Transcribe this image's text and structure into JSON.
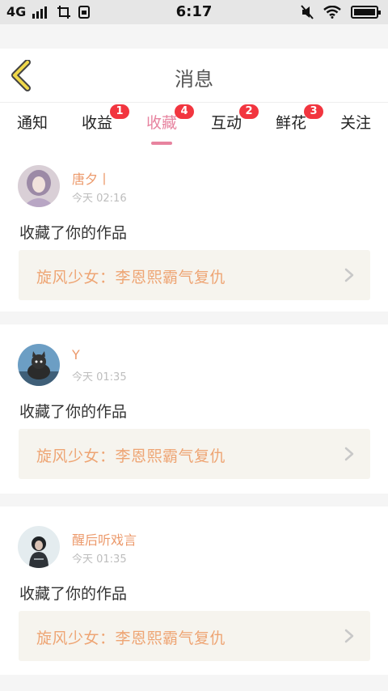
{
  "status_bar": {
    "network": "4G",
    "time": "6:17",
    "icons": [
      "signal-bars-icon",
      "screenshot-icon",
      "sim-icon",
      "mute-icon",
      "wifi-icon",
      "battery-icon"
    ]
  },
  "header": {
    "title": "消息",
    "back_icon": "chevron-left-icon",
    "back_color": "#f0d84a"
  },
  "tabs": [
    {
      "label": "通知",
      "badge": ""
    },
    {
      "label": "收益",
      "badge": "1"
    },
    {
      "label": "收藏",
      "badge": "4",
      "active": true
    },
    {
      "label": "互动",
      "badge": "2"
    },
    {
      "label": "鲜花",
      "badge": "3"
    },
    {
      "label": "关注",
      "badge": ""
    }
  ],
  "messages": [
    {
      "user": "唐夕丨",
      "time": "今天 02:16",
      "text": "收藏了你的作品",
      "work": "旋风少女：李恩熙霸气复仇"
    },
    {
      "user": "Y",
      "time": "今天 01:35",
      "text": "收藏了你的作品",
      "work": "旋风少女：李恩熙霸气复仇"
    },
    {
      "user": "醒后听戏言",
      "time": "今天 01:35",
      "text": "收藏了你的作品",
      "work": "旋风少女：李恩熙霸气复仇"
    }
  ],
  "colors": {
    "accent": "#e7839f",
    "badge": "#f2353f",
    "username": "#ec9a6c",
    "work_title": "#eea574"
  }
}
